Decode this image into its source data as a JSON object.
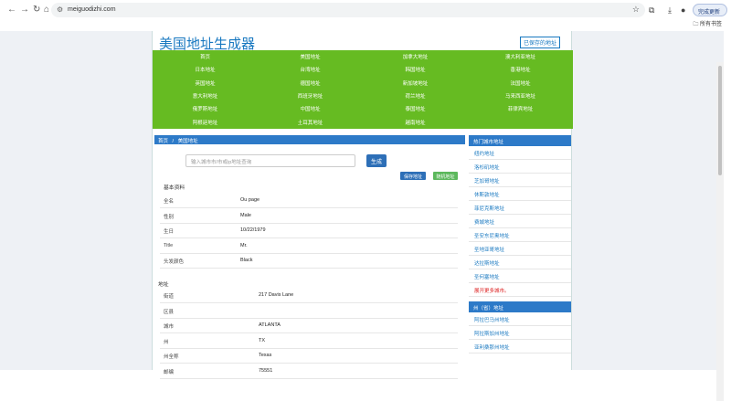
{
  "browser": {
    "url": "meiguodizhi.com",
    "update_label": "完成更新",
    "bookmarks_label": "所有书签"
  },
  "site": {
    "logo": "美国地址生成器",
    "aside_link": "已保存的地址"
  },
  "nav": [
    "首页",
    "美国地址",
    "加拿大地址",
    "澳大利亚地址",
    "日本地址",
    "台湾地址",
    "韩国地址",
    "香港地址",
    "英国地址",
    "德国地址",
    "新加坡地址",
    "法国地址",
    "意大利地址",
    "西班牙地址",
    "荷兰地址",
    "马来西亚地址",
    "俄罗斯地址",
    "中国地址",
    "泰国地址",
    "菲律宾地址",
    "阿根廷地址",
    "土耳其地址",
    "越南地址"
  ],
  "breadcrumb": {
    "home": "首页",
    "sep": "/",
    "current": "美国地址"
  },
  "search": {
    "placeholder": "输入城市市/市或ip地址查询",
    "button": "生成"
  },
  "actions": {
    "save": "保存地址",
    "random": "随机地址"
  },
  "basic": {
    "title": "基本资料",
    "rows": [
      {
        "k": "全名",
        "v": "Ou page"
      },
      {
        "k": "性别",
        "v": "Male"
      },
      {
        "k": "生日",
        "v": "10/22/1979"
      },
      {
        "k": "Title",
        "v": "Mr."
      },
      {
        "k": "头发颜色",
        "v": "Black"
      }
    ]
  },
  "address": {
    "title": "地址",
    "rows": [
      {
        "k": "街道",
        "v": "217  Davis Lane"
      },
      {
        "k": "区县",
        "v": ""
      },
      {
        "k": "城市",
        "v": "ATLANTA"
      },
      {
        "k": "州",
        "v": "TX"
      },
      {
        "k": "州全称",
        "v": "Texas"
      },
      {
        "k": "邮编",
        "v": "75551"
      }
    ]
  },
  "sidebar": {
    "hot_title": "热门城市地址",
    "hot": [
      "纽约地址",
      "洛杉矶地址",
      "芝加哥地址",
      "休斯敦地址",
      "菲尼克斯地址",
      "费城地址",
      "圣安东尼奥地址",
      "圣地亚哥地址",
      "达拉斯地址",
      "圣何塞地址"
    ],
    "more": "展开更多城市。",
    "state_title": "州（省）地址",
    "states": [
      "阿拉巴马州地址",
      "阿拉斯加州地址",
      "亚利桑那州地址"
    ]
  }
}
